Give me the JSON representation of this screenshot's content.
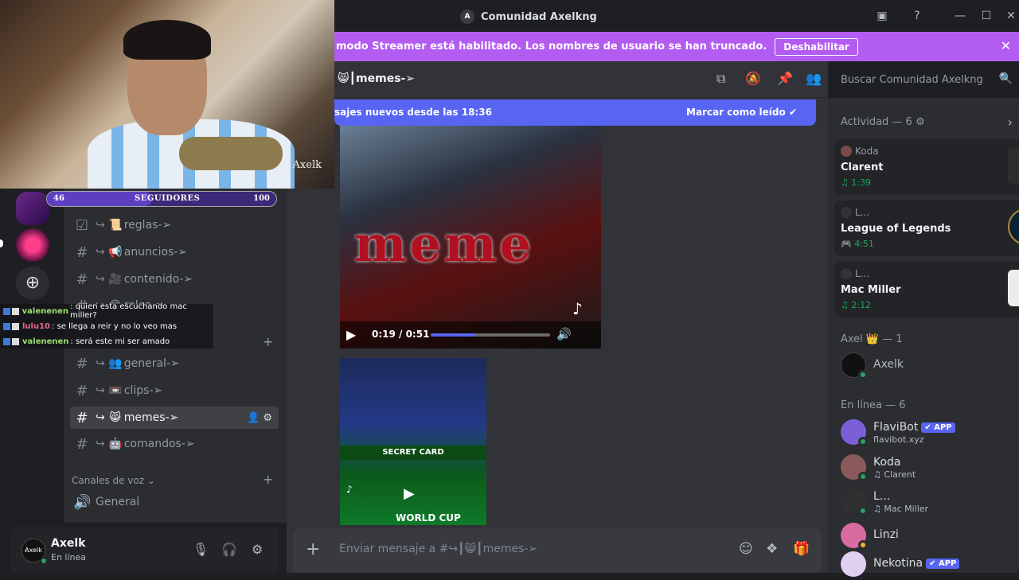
{
  "window": {
    "title": "Comunidad Axelkng",
    "controls": [
      "inbox",
      "help",
      "minimize",
      "maximize",
      "close"
    ]
  },
  "banner": {
    "text": "modo Streamer está habilitado. Los nombres de usuario se han truncado.",
    "button": "Deshabilitar"
  },
  "webcam": {
    "watermark": "Axelk"
  },
  "followers": {
    "current": "46",
    "label": "SEGUIDORES",
    "goal": "100",
    "progress": 0.46
  },
  "stream_chat": [
    {
      "user": "valenenen",
      "color": "#9adf6f",
      "message": ": quien esta escuchando mac miller?"
    },
    {
      "user": "lulu10",
      "color": "#e06a8a",
      "message": ": se llega a reir y no lo veo mas"
    },
    {
      "user": "valenenen",
      "color": "#9adf6f",
      "message": ": será este mi ser amado"
    }
  ],
  "sidebar": {
    "channels": [
      {
        "emoji": "📜",
        "label": "reglas-➢",
        "icon": "rules-icon"
      },
      {
        "emoji": "📢",
        "label": "anuncios-➢",
        "icon": "hash-icon"
      },
      {
        "emoji": "🎥",
        "label": "contenido-➢",
        "icon": "hash-icon"
      },
      {
        "emoji": "😊",
        "label": "roles-➢",
        "icon": "hash-icon"
      },
      {
        "emoji": "👥",
        "label": "general-➢",
        "icon": "hash-icon"
      },
      {
        "emoji": "📼",
        "label": "clips-➢",
        "icon": "hash-icon"
      },
      {
        "emoji": "😸",
        "label": "memes-➢",
        "icon": "hash-icon"
      },
      {
        "emoji": "🤖",
        "label": "comandos-➢",
        "icon": "hash-icon"
      }
    ],
    "voice_category": "Canales de voz",
    "voice_channels": [
      "General"
    ]
  },
  "user": {
    "name": "Axelk",
    "status": "En línea",
    "avatar_text": "Axelk"
  },
  "channel": {
    "name": "memes-➢",
    "emoji": "😸",
    "new_messages": "sajes nuevos desde las 18:36",
    "mark_read": "Marcar como leído"
  },
  "video1": {
    "overlay_text": "meme",
    "time": "0:19 / 0:51",
    "progress": 0.37
  },
  "video2": {
    "label": "SECRET CARD",
    "sub": "WORLD CUP"
  },
  "composer": {
    "placeholder": "Enviar mensaje a #↪┃😸┃memes-➢"
  },
  "search": {
    "placeholder": "Buscar Comunidad Axelkng"
  },
  "members": {
    "activity_header": "Actividad — 6",
    "activities": [
      {
        "user": "Koda",
        "game": "Clarent",
        "detail": "♫ 1:39",
        "art": "#2d2d2d"
      },
      {
        "user": "L...",
        "game": "League of Legends",
        "detail": "🎮 4:51",
        "art": "#0a2236"
      },
      {
        "user": "L...",
        "game": "Mac Miller",
        "detail": "♫ 2:12",
        "art": "#ececec"
      }
    ],
    "role_header": "Axel 👑 — 1",
    "role_members": [
      {
        "name": "Axelk",
        "color": "#111111"
      }
    ],
    "online_header": "En línea — 6",
    "online_members": [
      {
        "name": "FlaviBot",
        "tag": "✔ APP",
        "sub": "flavibot.xyz",
        "color": "#7b5fd9"
      },
      {
        "name": "Koda",
        "tag": "",
        "sub": "♫ Clarent",
        "color": "#8a5a5a"
      },
      {
        "name": "L...",
        "tag": "",
        "sub": "♫ Mac Miller",
        "color": "#303030"
      },
      {
        "name": "Linzi",
        "tag": "",
        "sub": "",
        "color": "#d96aa0"
      },
      {
        "name": "Nekotina",
        "tag": "✔ APP",
        "sub": "",
        "color": "#e0d0f0"
      }
    ]
  }
}
